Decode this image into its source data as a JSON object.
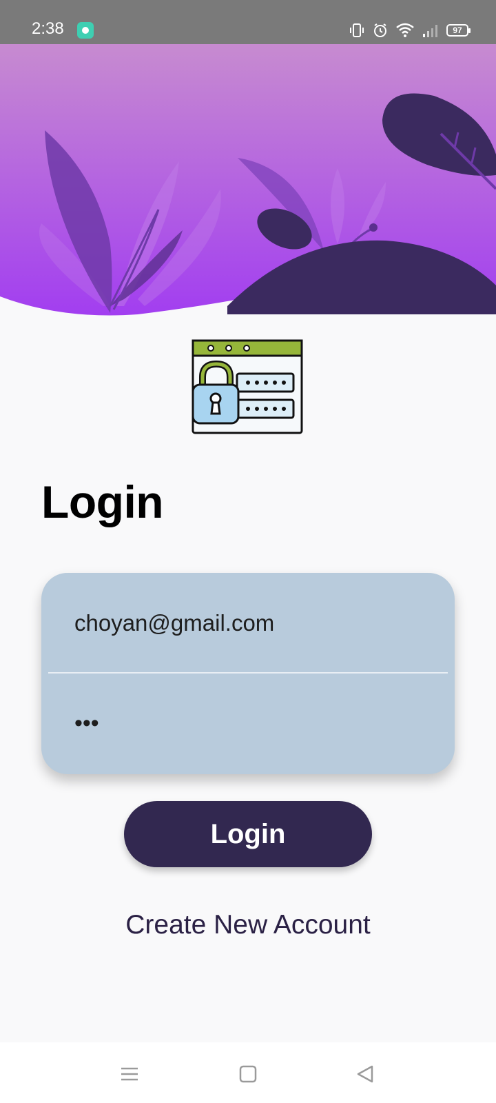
{
  "status_bar": {
    "time": "2:38",
    "battery_level": "97",
    "icons": [
      "app-notification-icon",
      "vibrate-icon",
      "alarm-icon",
      "wifi-icon",
      "cell-signal-icon",
      "battery-icon"
    ]
  },
  "hero": {
    "gradient_top": "#c78bd0",
    "gradient_bottom": "#a23ef0",
    "hill_color": "#3b2a5f"
  },
  "login": {
    "title": "Login",
    "email_value": "choyan@gmail.com",
    "password_value": "•••",
    "button_label": "Login",
    "create_account_label": "Create New Account"
  },
  "colors": {
    "card": "#b8cbdc",
    "button": "#322850",
    "link": "#2b2145",
    "lock_accent": "#96b63a"
  },
  "nav_bar": {
    "icons": [
      "menu-icon",
      "home-icon",
      "back-icon"
    ]
  }
}
